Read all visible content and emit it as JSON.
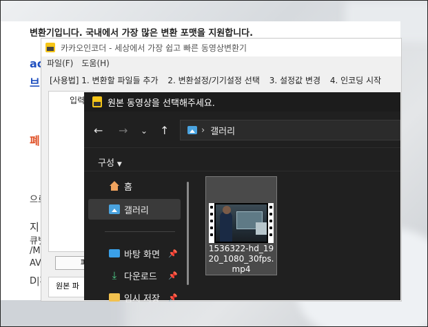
{
  "webpage": {
    "top_text": "변환기입니다. 국내에서 가장 많은 변환 포맷을 지원합니다.",
    "fragments": [
      "ac",
      "브",
      "폐",
      "으로",
      "지",
      "큐볏",
      "/M",
      "AV",
      "D|피"
    ]
  },
  "app": {
    "title": "카카오인코더 - 세상에서 가장 쉽고 빠른 동영상변환기",
    "menu": [
      "파일(F)",
      "도움(H)"
    ],
    "steps": [
      "[사용법] 1. 변환할 파일들 추가",
      "2. 변환설정/기기설정 선택",
      "3. 설정값 변경",
      "4. 인코딩 시작"
    ],
    "panel_label": "입력",
    "button_fragment": "파",
    "bottom_fragment": "원본 파"
  },
  "dialog": {
    "title": "원본 동영상을 선택해주세요.",
    "address": "갤러리",
    "organize_label": "구성",
    "nav_items": [
      {
        "label": "홈",
        "icon": "home-icon"
      },
      {
        "label": "갤러리",
        "icon": "gallery-icon"
      },
      {
        "label": "바탕 화면",
        "icon": "desktop-icon"
      },
      {
        "label": "다운로드",
        "icon": "download-icon"
      },
      {
        "label": "임시 저장",
        "icon": "folder-icon"
      }
    ],
    "file": {
      "name": "1536322-hd_1920_1080_30fps.mp4",
      "name_lines": [
        "1536322-hd_19",
        "20_1080_30fps.",
        "mp4"
      ]
    },
    "colors": {
      "dialog_bg": "#202020",
      "selected": "#3a3a3a",
      "accent": "#4aa3df"
    }
  }
}
